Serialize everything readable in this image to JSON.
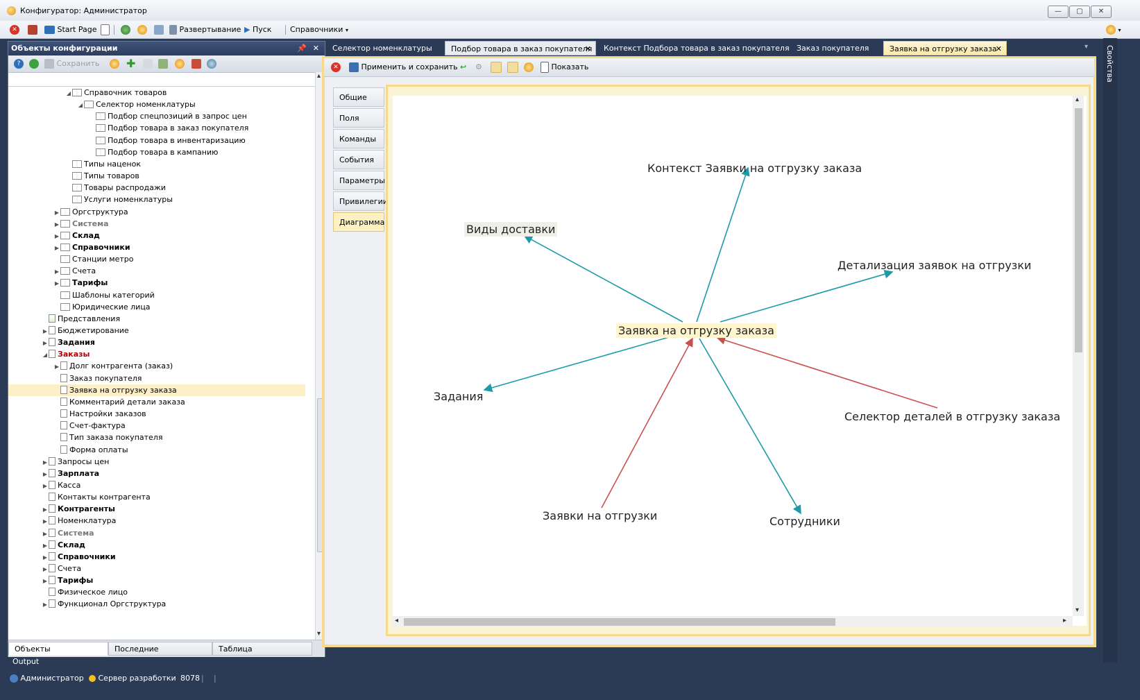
{
  "window": {
    "title": "Конфигуратор: Администратор"
  },
  "menubar": {
    "start_page": "Start Page",
    "deploy": "Развертывание",
    "run": "Пуск",
    "references": "Справочники"
  },
  "left_panel": {
    "title": "Объекты конфигурации",
    "save_label": "Сохранить",
    "tree": [
      {
        "label": "Справочник товаров",
        "level": 6,
        "exp": "◢",
        "icon": "book",
        "style": ""
      },
      {
        "label": "Селектор номенклатуры",
        "level": 7,
        "exp": "◢",
        "icon": "book",
        "style": ""
      },
      {
        "label": "Подбор спецпозиций в запрос цен",
        "level": 8,
        "exp": "",
        "icon": "book",
        "style": ""
      },
      {
        "label": "Подбор товара в заказ покупателя",
        "level": 8,
        "exp": "",
        "icon": "book",
        "style": ""
      },
      {
        "label": "Подбор товара в инвентаризацию",
        "level": 8,
        "exp": "",
        "icon": "book",
        "style": ""
      },
      {
        "label": "Подбор товара в кампанию",
        "level": 8,
        "exp": "",
        "icon": "book",
        "style": ""
      },
      {
        "label": "Типы наценок",
        "level": 6,
        "exp": "",
        "icon": "book",
        "style": ""
      },
      {
        "label": "Типы товаров",
        "level": 6,
        "exp": "",
        "icon": "book",
        "style": ""
      },
      {
        "label": "Товары распродажи",
        "level": 6,
        "exp": "",
        "icon": "book",
        "style": ""
      },
      {
        "label": "Услуги номенклатуры",
        "level": 6,
        "exp": "",
        "icon": "book",
        "style": ""
      },
      {
        "label": "Оргструктура",
        "level": 5,
        "exp": "▶",
        "icon": "book",
        "style": ""
      },
      {
        "label": "Система",
        "level": 5,
        "exp": "▶",
        "icon": "book",
        "style": "gray"
      },
      {
        "label": "Склад",
        "level": 5,
        "exp": "▶",
        "icon": "book",
        "style": "bold"
      },
      {
        "label": "Справочники",
        "level": 5,
        "exp": "▶",
        "icon": "book",
        "style": "bold"
      },
      {
        "label": "Станции метро",
        "level": 5,
        "exp": "",
        "icon": "book",
        "style": ""
      },
      {
        "label": "Счета",
        "level": 5,
        "exp": "▶",
        "icon": "book",
        "style": ""
      },
      {
        "label": "Тарифы",
        "level": 5,
        "exp": "▶",
        "icon": "book",
        "style": "bold"
      },
      {
        "label": "Шаблоны категорий",
        "level": 5,
        "exp": "",
        "icon": "book",
        "style": ""
      },
      {
        "label": "Юридические лица",
        "level": 5,
        "exp": "",
        "icon": "book",
        "style": ""
      },
      {
        "label": "Представления",
        "level": 4,
        "exp": "",
        "icon": "rep",
        "style": ""
      },
      {
        "label": "Бюджетирование",
        "level": 4,
        "exp": "▶",
        "icon": "page",
        "style": ""
      },
      {
        "label": "Задания",
        "level": 4,
        "exp": "▶",
        "icon": "page",
        "style": "bold"
      },
      {
        "label": "Заказы",
        "level": 4,
        "exp": "◢",
        "icon": "page",
        "style": "red"
      },
      {
        "label": "Долг контрагента (заказ)",
        "level": 5,
        "exp": "▶",
        "icon": "page",
        "style": ""
      },
      {
        "label": "Заказ покупателя",
        "level": 5,
        "exp": "",
        "icon": "page",
        "style": ""
      },
      {
        "label": "Заявка на отгрузку заказа",
        "level": 5,
        "exp": "",
        "icon": "page",
        "style": "sel"
      },
      {
        "label": "Комментарий детали заказа",
        "level": 5,
        "exp": "",
        "icon": "page",
        "style": ""
      },
      {
        "label": "Настройки заказов",
        "level": 5,
        "exp": "",
        "icon": "page",
        "style": ""
      },
      {
        "label": "Счет-фактура",
        "level": 5,
        "exp": "",
        "icon": "page",
        "style": ""
      },
      {
        "label": "Тип заказа покупателя",
        "level": 5,
        "exp": "",
        "icon": "page",
        "style": ""
      },
      {
        "label": "Форма оплаты",
        "level": 5,
        "exp": "",
        "icon": "page",
        "style": ""
      },
      {
        "label": "Запросы цен",
        "level": 4,
        "exp": "▶",
        "icon": "page",
        "style": ""
      },
      {
        "label": "Зарплата",
        "level": 4,
        "exp": "▶",
        "icon": "page",
        "style": "bold"
      },
      {
        "label": "Касса",
        "level": 4,
        "exp": "▶",
        "icon": "page",
        "style": ""
      },
      {
        "label": "Контакты контрагента",
        "level": 4,
        "exp": "",
        "icon": "page",
        "style": ""
      },
      {
        "label": "Контрагенты",
        "level": 4,
        "exp": "▶",
        "icon": "page",
        "style": "bold"
      },
      {
        "label": "Номенклатура",
        "level": 4,
        "exp": "▶",
        "icon": "page",
        "style": ""
      },
      {
        "label": "Система",
        "level": 4,
        "exp": "▶",
        "icon": "page",
        "style": "gray"
      },
      {
        "label": "Склад",
        "level": 4,
        "exp": "▶",
        "icon": "page",
        "style": "bold"
      },
      {
        "label": "Справочники",
        "level": 4,
        "exp": "▶",
        "icon": "page",
        "style": "bold"
      },
      {
        "label": "Счета",
        "level": 4,
        "exp": "▶",
        "icon": "page",
        "style": ""
      },
      {
        "label": "Тарифы",
        "level": 4,
        "exp": "▶",
        "icon": "page",
        "style": "bold"
      },
      {
        "label": "Физическое лицо",
        "level": 4,
        "exp": "",
        "icon": "page",
        "style": ""
      },
      {
        "label": "Функционал Оргструктура",
        "level": 4,
        "exp": "▶",
        "icon": "page",
        "style": ""
      }
    ],
    "tabs": [
      "Объекты",
      "Последние",
      "Таблица"
    ]
  },
  "doc_tabs": [
    "Селектор номенклатуры",
    "Подбор товара в заказ покупателя",
    "Контекст Подбора товара в заказ покупателя",
    "Заказ покупателя",
    "Заявка на отгрузку заказа"
  ],
  "doc_toolbar": {
    "apply_save": "Применить и сохранить",
    "show": "Показать"
  },
  "side_tabs": [
    "Общие",
    "Поля",
    "Команды",
    "События",
    "Параметры",
    "Привилегии",
    "Диаграмма"
  ],
  "diagram": {
    "center": "Заявка на отгрузку заказа",
    "nodes": {
      "context": "Контекст Заявки на отгрузку заказа",
      "delivery": "Виды доставки",
      "detail": "Детализация заявок на отгрузки",
      "tasks": "Задания",
      "selector": "Селектор деталей в отгрузку заказа",
      "requests": "Заявки на отгрузки",
      "staff": "Сотрудники"
    },
    "colors": {
      "outgoing": "#1b9aa8",
      "incoming": "#c9504d"
    }
  },
  "right_strip": "Свойства",
  "output_label": "Output",
  "status": {
    "user": "Администратор",
    "server": "Сервер разработки",
    "port": "8078"
  }
}
